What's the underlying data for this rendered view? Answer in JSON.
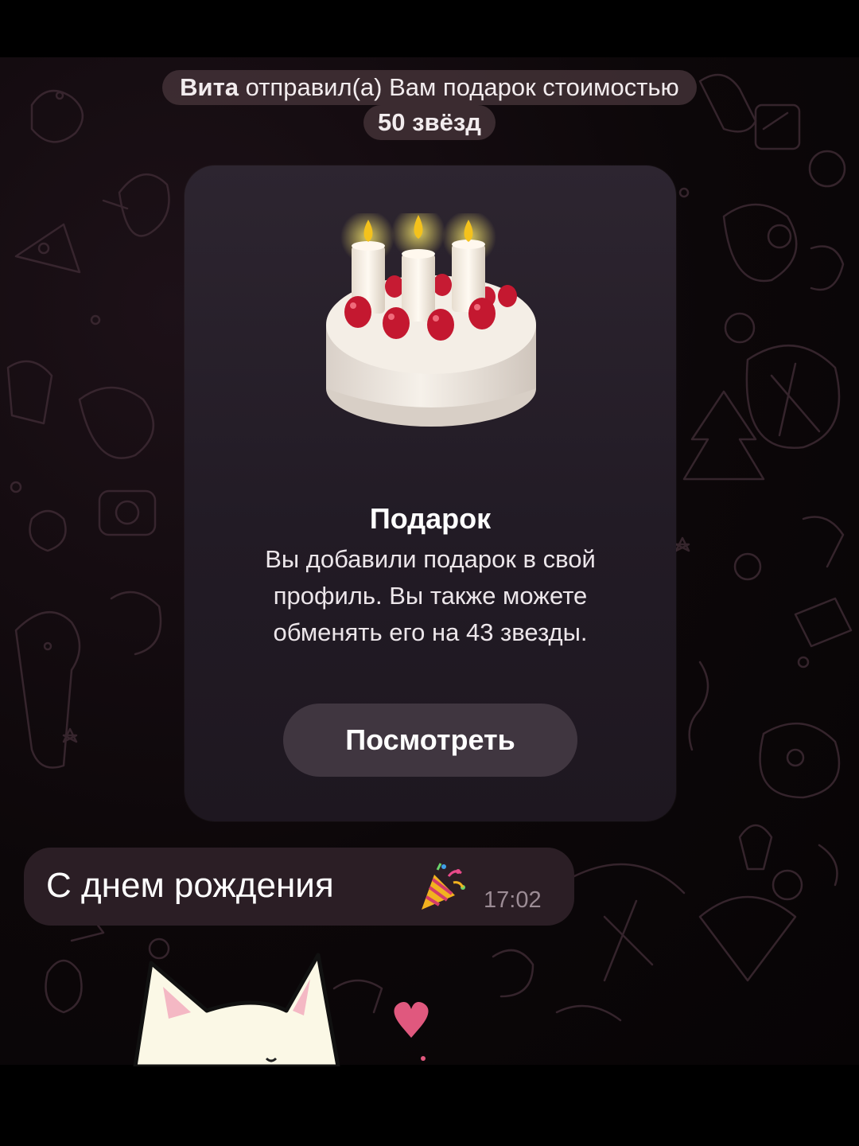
{
  "service_message": {
    "sender": "Вита",
    "text": "отправил(а) Вам подарок стоимостью",
    "amount": "50 звёзд"
  },
  "gift_card": {
    "title": "Подарок",
    "description": "Вы добавили подарок в свой профиль. Вы также можете обменять его на 43 звезды.",
    "button_label": "Посмотреть",
    "icon": "birthday-cake-icon"
  },
  "message": {
    "text": "С днем рождения",
    "emoji": "party-popper-icon",
    "time": "17:02"
  },
  "sticker": {
    "icon": "white-cat-sticker"
  },
  "colors": {
    "background": "#000000",
    "card": "#2a222c",
    "button": "#403640",
    "bubble": "#2b1e25",
    "heart": "#e0587e"
  }
}
